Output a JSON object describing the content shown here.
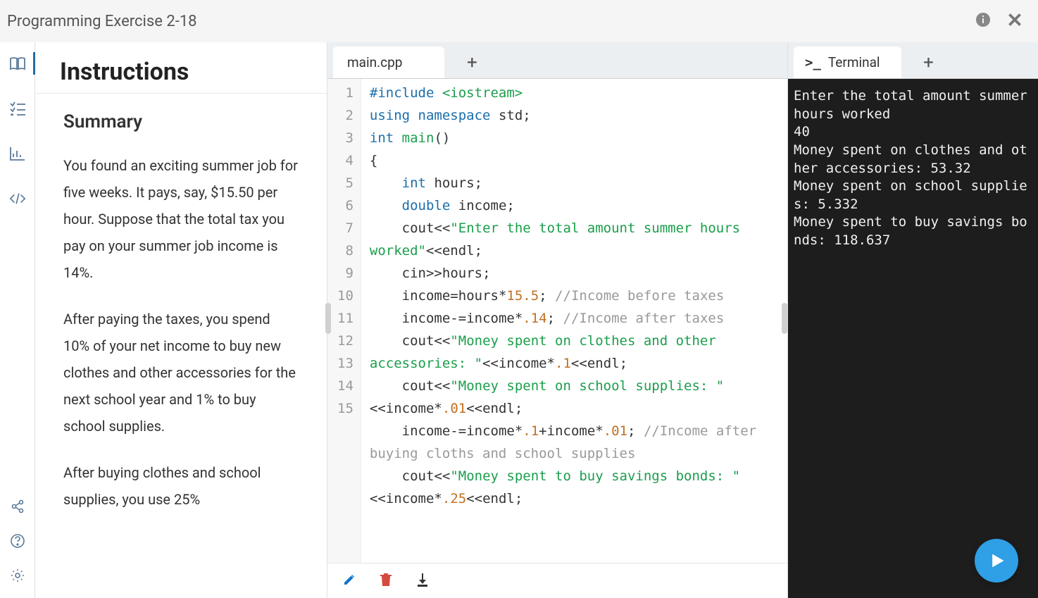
{
  "title": "Programming Exercise 2-18",
  "instructions": {
    "heading": "Instructions",
    "summary_heading": "Summary",
    "para1": "You found an exciting summer job for five weeks. It pays, say, $15.50 per hour. Suppose that the total tax you pay on your summer job income is 14%.",
    "para2": "After paying the taxes, you spend 10% of your net income to buy new clothes and other accessories for the next school year and 1% to buy school supplies.",
    "para3": "After buying clothes and school supplies, you use 25%"
  },
  "editor": {
    "tab_label": "main.cpp",
    "lines": [
      [
        [
          "inc",
          "#include"
        ],
        [
          "sp",
          " "
        ],
        [
          "header",
          "<iostream>"
        ]
      ],
      [
        [
          "kw",
          "using"
        ],
        [
          "sp",
          " "
        ],
        [
          "kw",
          "namespace"
        ],
        [
          "sp",
          " "
        ],
        [
          "txt",
          "std"
        ],
        [
          "op",
          ";"
        ]
      ],
      [
        [
          "txt",
          ""
        ]
      ],
      [
        [
          "type",
          "int"
        ],
        [
          "sp",
          " "
        ],
        [
          "fn",
          "main"
        ],
        [
          "op",
          "()"
        ]
      ],
      [
        [
          "op",
          "{"
        ]
      ],
      [
        [
          "sp",
          "    "
        ],
        [
          "type",
          "int"
        ],
        [
          "sp",
          " "
        ],
        [
          "txt",
          "hours"
        ],
        [
          "op",
          ";"
        ]
      ],
      [
        [
          "sp",
          "    "
        ],
        [
          "type",
          "double"
        ],
        [
          "sp",
          " "
        ],
        [
          "txt",
          "income"
        ],
        [
          "op",
          ";"
        ]
      ],
      [
        [
          "sp",
          "    "
        ],
        [
          "txt",
          "cout"
        ],
        [
          "op",
          "<<"
        ],
        [
          "str",
          "\"Enter the total amount summer hours worked\""
        ],
        [
          "op",
          "<<"
        ],
        [
          "txt",
          "endl"
        ],
        [
          "op",
          ";"
        ]
      ],
      [
        [
          "sp",
          "    "
        ],
        [
          "txt",
          "cin"
        ],
        [
          "op",
          ">>"
        ],
        [
          "txt",
          "hours"
        ],
        [
          "op",
          ";"
        ]
      ],
      [
        [
          "sp",
          "    "
        ],
        [
          "txt",
          "income"
        ],
        [
          "op",
          "="
        ],
        [
          "txt",
          "hours"
        ],
        [
          "op",
          "*"
        ],
        [
          "num",
          "15.5"
        ],
        [
          "op",
          "; "
        ],
        [
          "cmt",
          "//Income before taxes"
        ]
      ],
      [
        [
          "sp",
          "    "
        ],
        [
          "txt",
          "income"
        ],
        [
          "op",
          "-="
        ],
        [
          "txt",
          "income"
        ],
        [
          "op",
          "*"
        ],
        [
          "num",
          ".14"
        ],
        [
          "op",
          "; "
        ],
        [
          "cmt",
          "//Income after taxes"
        ]
      ],
      [
        [
          "sp",
          "    "
        ],
        [
          "txt",
          "cout"
        ],
        [
          "op",
          "<<"
        ],
        [
          "str",
          "\"Money spent on clothes and other accessories: \""
        ],
        [
          "op",
          "<<"
        ],
        [
          "txt",
          "income"
        ],
        [
          "op",
          "*"
        ],
        [
          "num",
          ".1"
        ],
        [
          "op",
          "<<"
        ],
        [
          "txt",
          "endl"
        ],
        [
          "op",
          ";"
        ]
      ],
      [
        [
          "sp",
          "    "
        ],
        [
          "txt",
          "cout"
        ],
        [
          "op",
          "<<"
        ],
        [
          "str",
          "\"Money spent on school supplies: \""
        ],
        [
          "op",
          "<<"
        ],
        [
          "txt",
          "income"
        ],
        [
          "op",
          "*"
        ],
        [
          "num",
          ".01"
        ],
        [
          "op",
          "<<"
        ],
        [
          "txt",
          "endl"
        ],
        [
          "op",
          ";"
        ]
      ],
      [
        [
          "sp",
          "    "
        ],
        [
          "txt",
          "income"
        ],
        [
          "op",
          "-="
        ],
        [
          "txt",
          "income"
        ],
        [
          "op",
          "*"
        ],
        [
          "num",
          ".1"
        ],
        [
          "op",
          "+"
        ],
        [
          "txt",
          "income"
        ],
        [
          "op",
          "*"
        ],
        [
          "num",
          ".01"
        ],
        [
          "op",
          "; "
        ],
        [
          "cmt",
          "//Income after buying cloths and school supplies"
        ]
      ],
      [
        [
          "sp",
          "    "
        ],
        [
          "txt",
          "cout"
        ],
        [
          "op",
          "<<"
        ],
        [
          "str",
          "\"Money spent to buy savings bonds: \""
        ],
        [
          "op",
          "<<"
        ],
        [
          "txt",
          "income"
        ],
        [
          "op",
          "*"
        ],
        [
          "num",
          ".25"
        ],
        [
          "op",
          "<<"
        ],
        [
          "txt",
          "endl"
        ],
        [
          "op",
          ";"
        ]
      ]
    ]
  },
  "terminal": {
    "tab_label": "Terminal",
    "output": "Enter the total amount summer hours worked\n40\nMoney spent on clothes and other accessories: 53.32\nMoney spent on school supplies: 5.332\nMoney spent to buy savings bonds: 118.637"
  }
}
